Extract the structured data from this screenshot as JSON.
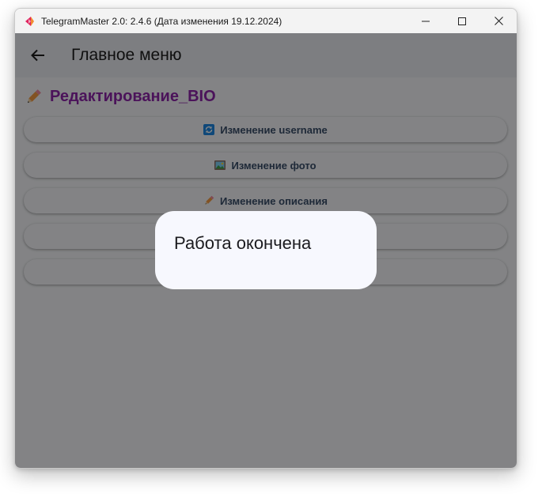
{
  "window": {
    "title": "TelegramMaster 2.0: 2.4.6 (Дата изменения 19.12.2024)",
    "controls": [
      "minimize-icon",
      "maximize-icon",
      "close-icon"
    ]
  },
  "appbar": {
    "back_icon": "arrow-left-icon",
    "title": "Главное меню"
  },
  "section": {
    "icon": "pencil-icon",
    "title": "Редактирование_BIO",
    "color": "#8e24aa"
  },
  "menu": {
    "items": [
      {
        "label": "Изменение username",
        "icon": "refresh-icon"
      },
      {
        "label": "Изменение фото",
        "icon": "picture-icon"
      },
      {
        "label": "Изменение описания",
        "icon": "pencil-icon"
      },
      {
        "label": "",
        "icon": ""
      },
      {
        "label": "",
        "icon": ""
      }
    ]
  },
  "dialog": {
    "message": "Работа окончена"
  }
}
